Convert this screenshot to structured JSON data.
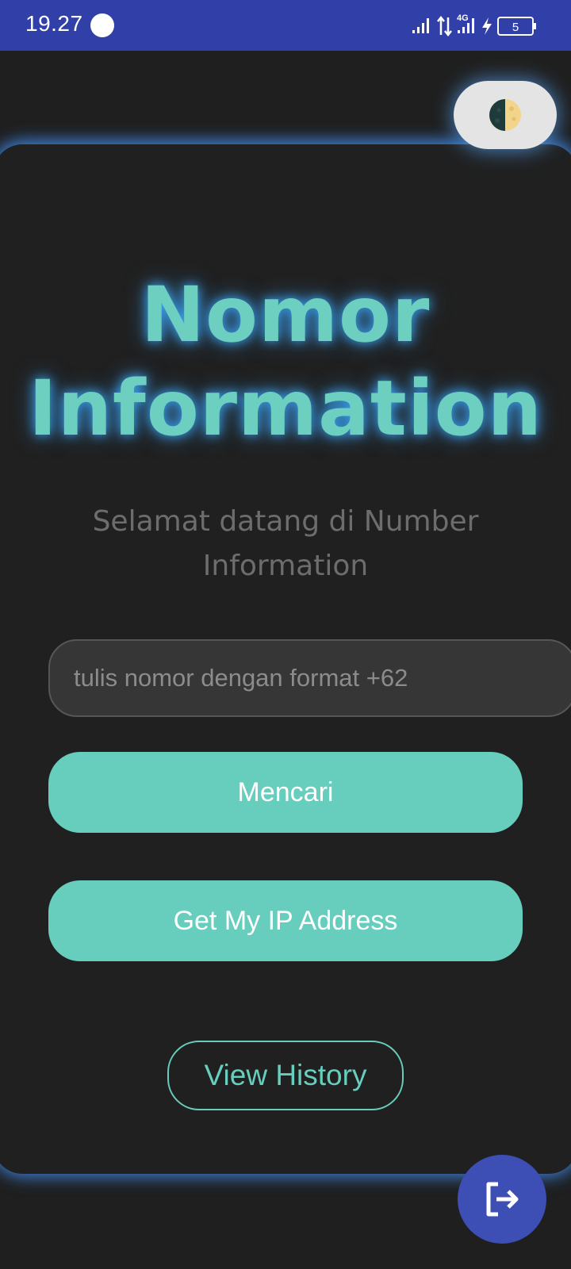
{
  "status_bar": {
    "time": "19.27",
    "network_type": "4G",
    "battery_level": "5",
    "icons": [
      "notification-dot-icon",
      "signal-icon",
      "data-transfer-icon",
      "signal-4g-icon",
      "charging-icon",
      "battery-icon"
    ]
  },
  "theme_toggle": {
    "icon": "half-moon-icon"
  },
  "title": {
    "line1": "Nomor",
    "line2": "Information"
  },
  "subtitle": "Selamat datang di Number Information",
  "phone_input": {
    "placeholder": "tulis nomor dengan format +62",
    "value": ""
  },
  "buttons": {
    "search_label": "Mencari",
    "ip_label": "Get My IP Address",
    "history_label": "View History"
  },
  "fab": {
    "icon": "logout-icon"
  },
  "colors": {
    "accent": "#67cdbd",
    "status_bar": "#3040a8",
    "background": "#1f1f1f",
    "fab": "#3d4fb5",
    "glow": "#46a0ff"
  }
}
